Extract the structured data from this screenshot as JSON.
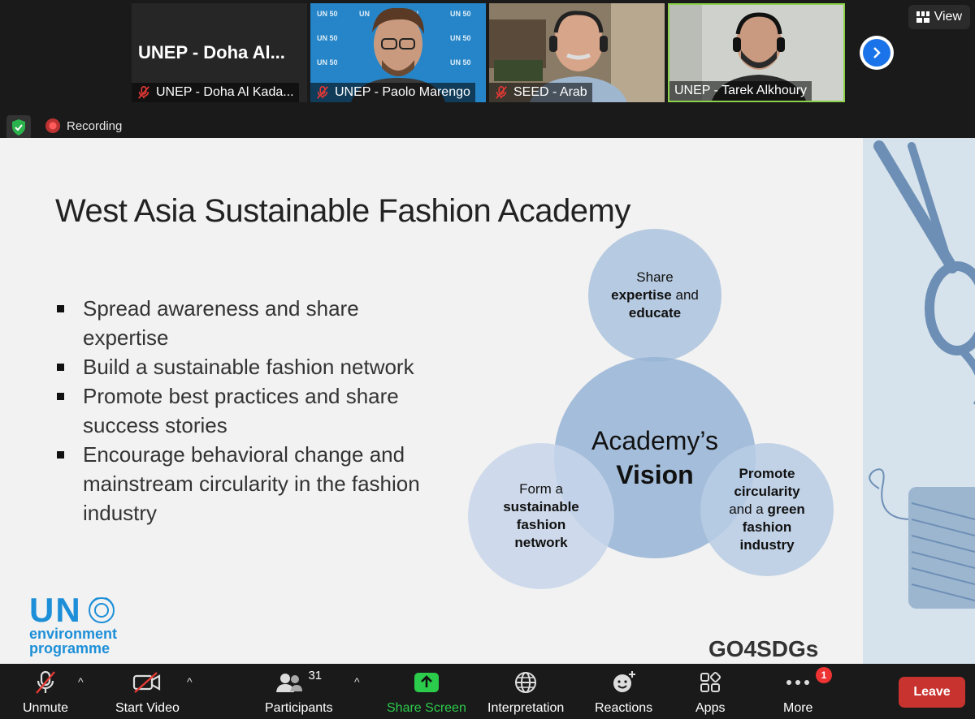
{
  "window": {
    "view_label": "View",
    "recording_label": "Recording"
  },
  "participants_strip": {
    "tiles": [
      {
        "name": "UNEP - Doha Al Kada...",
        "display_name": "UNEP - Doha Al...",
        "muted": true
      },
      {
        "name": "UNEP - Paolo Marengo",
        "muted": true
      },
      {
        "name": "SEED - Arab",
        "muted": true
      },
      {
        "name": "UNEP - Tarek Alkhoury",
        "muted": false
      }
    ]
  },
  "slide": {
    "title": "West Asia Sustainable Fashion Academy",
    "bullets": [
      "Spread awareness and share expertise",
      "Build a sustainable fashion network",
      "Promote best practices and share success stories",
      "Encourage behavioral change and mainstream circularity in the fashion industry"
    ],
    "vision": {
      "top": {
        "pre": "Share",
        "bold1": "expertise",
        "mid": " and",
        "bold2": "educate"
      },
      "center": {
        "line1": "Academy’s",
        "line2": "Vision"
      },
      "left": {
        "pre": "Form a",
        "bold1": "sustainable",
        "bold2": "fashion",
        "bold3": "network"
      },
      "right": {
        "bold1": "Promote",
        "bold2": "circularity",
        "mid": "and a ",
        "bold3": "green",
        "bold4": "fashion",
        "bold5": "industry"
      }
    },
    "logo_un": "UN",
    "logo_env1": "environment",
    "logo_env2": "programme",
    "logo_go4sdgs": "GO4SDGs"
  },
  "toolbar": {
    "unmute": "Unmute",
    "start_video": "Start Video",
    "participants": "Participants",
    "participants_count": "31",
    "share_screen": "Share Screen",
    "interpretation": "Interpretation",
    "reactions": "Reactions",
    "apps": "Apps",
    "more": "More",
    "more_badge": "1",
    "leave": "Leave"
  },
  "colors": {
    "share_green": "#2bcb4b",
    "leave_red": "#c8332f",
    "un_blue": "#1d8fd8"
  }
}
